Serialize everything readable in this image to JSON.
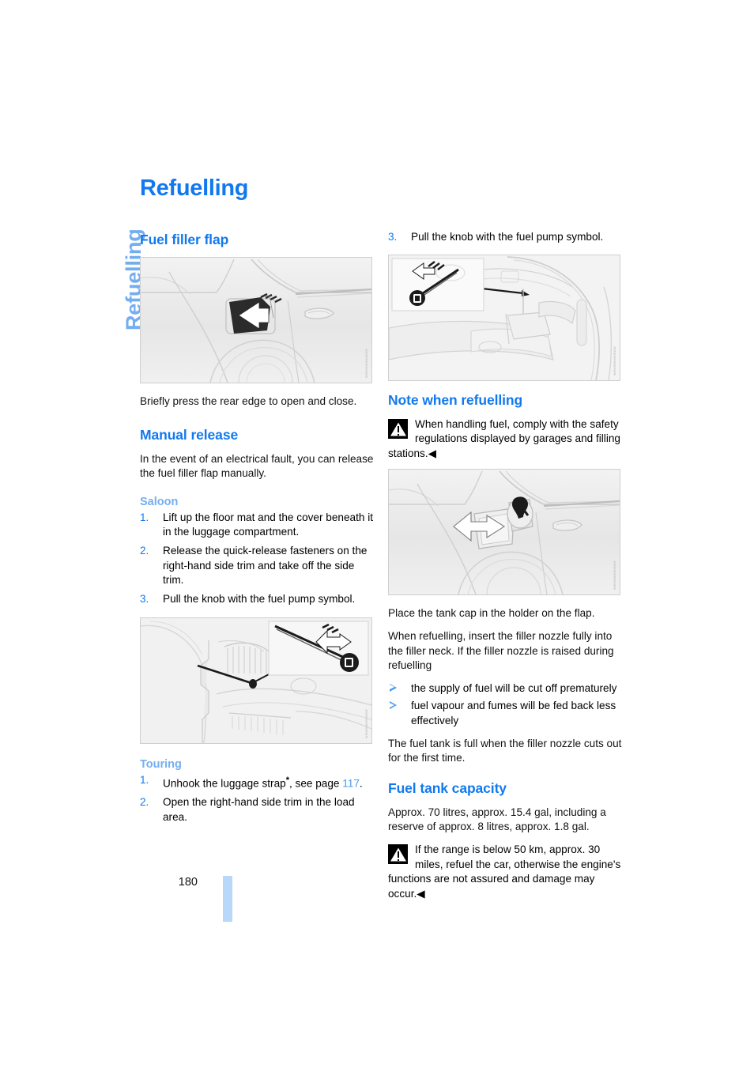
{
  "page": {
    "running_head": "Refuelling",
    "title": "Refuelling",
    "number": "180"
  },
  "left_column": {
    "section_heading": "Fuel filler flap",
    "figure_flap_closed": {
      "name": "fuel-filler-flap-closed-illustration",
      "credit": "WWWWWWWWWW"
    },
    "caption": "Briefly press the rear edge to open and close.",
    "manual_release": {
      "heading": "Manual release",
      "intro": "In the event of an electrical fault, you can release the fuel filler flap manually."
    },
    "saloon": {
      "heading": "Saloon",
      "steps": [
        {
          "num": "1.",
          "text": "Lift up the floor mat and the cover beneath it in the luggage compartment."
        },
        {
          "num": "2.",
          "text": "Release the quick-release fasteners on the right-hand side trim and take off the side trim."
        },
        {
          "num": "3.",
          "text": "Pull the knob with the fuel pump symbol."
        }
      ]
    },
    "figure_saloon_knob": {
      "name": "saloon-release-knob-illustration",
      "credit": "WWWWWWWWWW"
    },
    "touring": {
      "heading": "Touring",
      "steps": [
        {
          "num": "1.",
          "text_before": "Unhook the luggage strap",
          "asterisk": "*",
          "text_mid": ", see page ",
          "page_ref": "117",
          "text_after": "."
        },
        {
          "num": "2.",
          "text": "Open the right-hand side trim in the load area."
        }
      ]
    }
  },
  "right_column": {
    "step_three": {
      "num": "3.",
      "text": "Pull the knob with the fuel pump symbol."
    },
    "figure_touring_knob": {
      "name": "touring-release-knob-illustration",
      "credit": "WWWWWWWWWW"
    },
    "note": {
      "heading": "Note when refuelling",
      "warning_text": "When handling fuel, comply with the safety regulations displayed by garages and filling stations.",
      "end_mark": "◀"
    },
    "figure_flap_open": {
      "name": "fuel-filler-flap-open-illustration",
      "credit": "WWWWWWWWWW"
    },
    "paragraphs": [
      "Place the tank cap in the holder on the flap.",
      "When refuelling, insert the filler nozzle fully into the filler neck. If the filler nozzle is raised during refuelling"
    ],
    "bullets": [
      "the supply of fuel will be cut off prematurely",
      "fuel vapour and fumes will be fed back less effectively"
    ],
    "closing_paragraph": "The fuel tank is full when the filler nozzle cuts out for the first time.",
    "capacity": {
      "heading": "Fuel tank capacity",
      "text": "Approx. 70 litres, approx. 15.4 gal, including a reserve of approx. 8 litres, approx. 1.8 gal.",
      "warning_text": "If the range is below 50 km, approx. 30 miles, refuel the car, otherwise the engine's functions are not assured and damage may occur.",
      "end_mark": "◀"
    }
  },
  "colors": {
    "heading_blue": "#1179ef",
    "subheading_blue": "#74aef0",
    "page_bar_blue": "#b9d7f8",
    "text_black": "#111111"
  }
}
